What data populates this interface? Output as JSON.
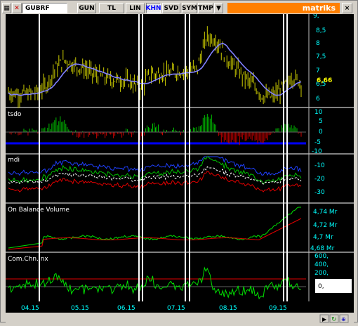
{
  "toolbar": {
    "symbol": "GUBRF",
    "buttons": [
      "GUN",
      "TL",
      "LIN",
      "KHN",
      "SVD",
      "SYM",
      "TMP"
    ],
    "active_button": "KHN",
    "dropdown_arrow": "▼",
    "brand": "matriks",
    "close_label": "×",
    "colors": {
      "accent": "#ff7f00",
      "active": "#0000ff"
    }
  },
  "panels": {
    "price": {
      "label": "",
      "last_value": "6,66",
      "ticks": [
        "9,",
        "8,5",
        "8",
        "7,5",
        "7",
        "6,5",
        "6"
      ],
      "color_price": "#cccc00",
      "color_ma": "#8080ff"
    },
    "tsdo": {
      "label": "tsdo",
      "ticks": [
        "10",
        "5",
        "0",
        "-5",
        "-10"
      ]
    },
    "mdi": {
      "label": "mdi",
      "ticks": [
        "-10",
        "-20",
        "-30"
      ]
    },
    "obv": {
      "label": "On Balance Volume",
      "ticks": [
        "4,74 Mr",
        "4,72 Mr",
        "4,7 Mr",
        "4,68 Mr"
      ]
    },
    "cci": {
      "label": "Com.Chn.Inx",
      "ticks": [
        "600,",
        "400,",
        "200,",
        "0,"
      ],
      "value_box": "0,"
    }
  },
  "time_axis": [
    "04.15",
    "05.15",
    "06.15",
    "07.15",
    "08.15",
    "09.15"
  ],
  "chart_data": [
    {
      "type": "line",
      "title": "",
      "series": [
        {
          "name": "",
          "values": [
            6.35,
            6.3,
            6.3,
            6.35,
            6.6,
            7.2,
            7.5,
            7.3,
            7.2,
            7.0,
            6.9,
            6.8,
            6.8,
            6.7,
            6.5,
            7.0,
            7.0,
            7.0,
            7.1,
            7.1,
            7.2,
            8.3,
            8.2,
            7.6,
            7.2,
            6.9,
            6.6,
            6.2,
            6.2,
            6.5,
            6.9,
            6.7
          ]
        }
      ],
      "ylim": [
        5.9,
        9.1
      ]
    }
  ]
}
